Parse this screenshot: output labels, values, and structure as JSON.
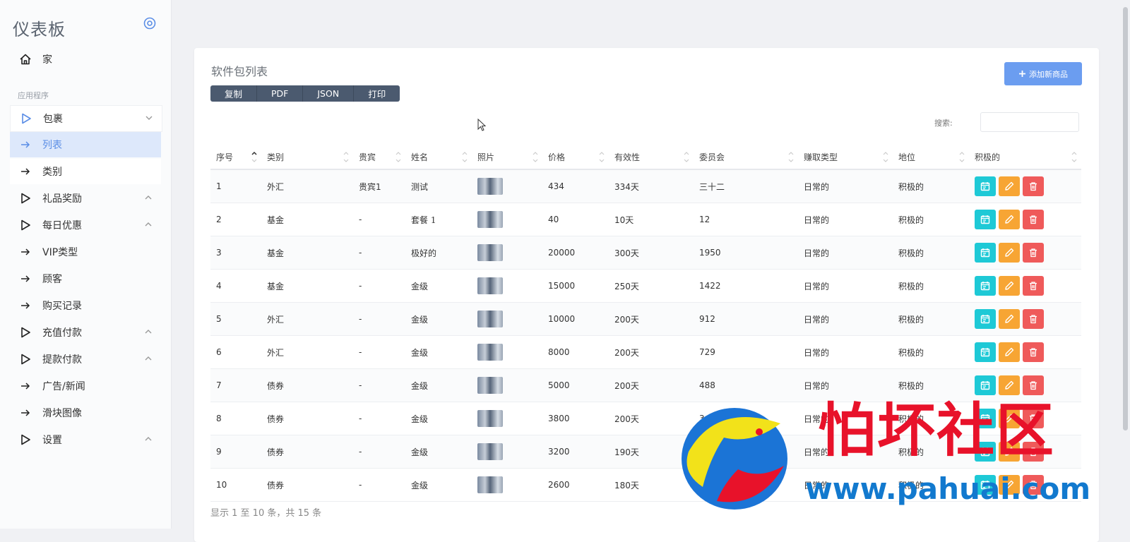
{
  "sidebar": {
    "brand": "仪表板",
    "home": "家",
    "section": "应用程序",
    "items": [
      {
        "label": "包裹"
      },
      {
        "label": "列表"
      },
      {
        "label": "类别"
      },
      {
        "label": "礼品奖励"
      },
      {
        "label": "每日优惠"
      },
      {
        "label": "VIP类型"
      },
      {
        "label": "顾客"
      },
      {
        "label": "购买记录"
      },
      {
        "label": "充值付款"
      },
      {
        "label": "提款付款"
      },
      {
        "label": "广告/新闻"
      },
      {
        "label": "滑块图像"
      },
      {
        "label": "设置"
      }
    ]
  },
  "card": {
    "title": "软件包列表",
    "add_button": "添加新商品",
    "export": [
      "复制",
      "PDF",
      "JSON",
      "打印"
    ],
    "search_label": "搜索:"
  },
  "table": {
    "headers": [
      "序号",
      "类别",
      "贵宾",
      "姓名",
      "照片",
      "价格",
      "有效性",
      "委员会",
      "赚取类型",
      "地位",
      "积极的"
    ],
    "rows": [
      [
        "1",
        "外汇",
        "贵宾1",
        "测试",
        "434",
        "334天",
        "三十二",
        "日常的",
        "积极的"
      ],
      [
        "2",
        "基金",
        "-",
        "套餐 1",
        "40",
        "10天",
        "12",
        "日常的",
        "积极的"
      ],
      [
        "3",
        "基金",
        "-",
        "极好的",
        "20000",
        "300天",
        "1950",
        "日常的",
        "积极的"
      ],
      [
        "4",
        "基金",
        "-",
        "金级",
        "15000",
        "250天",
        "1422",
        "日常的",
        "积极的"
      ],
      [
        "5",
        "外汇",
        "-",
        "金级",
        "10000",
        "200天",
        "912",
        "日常的",
        "积极的"
      ],
      [
        "6",
        "外汇",
        "-",
        "金级",
        "8000",
        "200天",
        "729",
        "日常的",
        "积极的"
      ],
      [
        "7",
        "债券",
        "-",
        "金级",
        "5000",
        "200天",
        "488",
        "日常的",
        "积极的"
      ],
      [
        "8",
        "债券",
        "-",
        "金级",
        "3800",
        "200天",
        "3",
        "日常的",
        "积极的"
      ],
      [
        "9",
        "债券",
        "-",
        "金级",
        "3200",
        "190天",
        "",
        "日常的",
        "积极的"
      ],
      [
        "10",
        "债券",
        "-",
        "金级",
        "2600",
        "180天",
        "",
        "日常的",
        "积极的"
      ]
    ]
  },
  "info": "显示 1 至 10 条，共 15 条",
  "watermark": {
    "text": "怕坏社区",
    "url": "www.pahuai.com"
  },
  "colors": {
    "accent": "#6b9df0",
    "cyan": "#1ec9d6",
    "orange": "#f7a534",
    "red": "#ef5a5a",
    "export_bg": "#4b5a6f"
  }
}
